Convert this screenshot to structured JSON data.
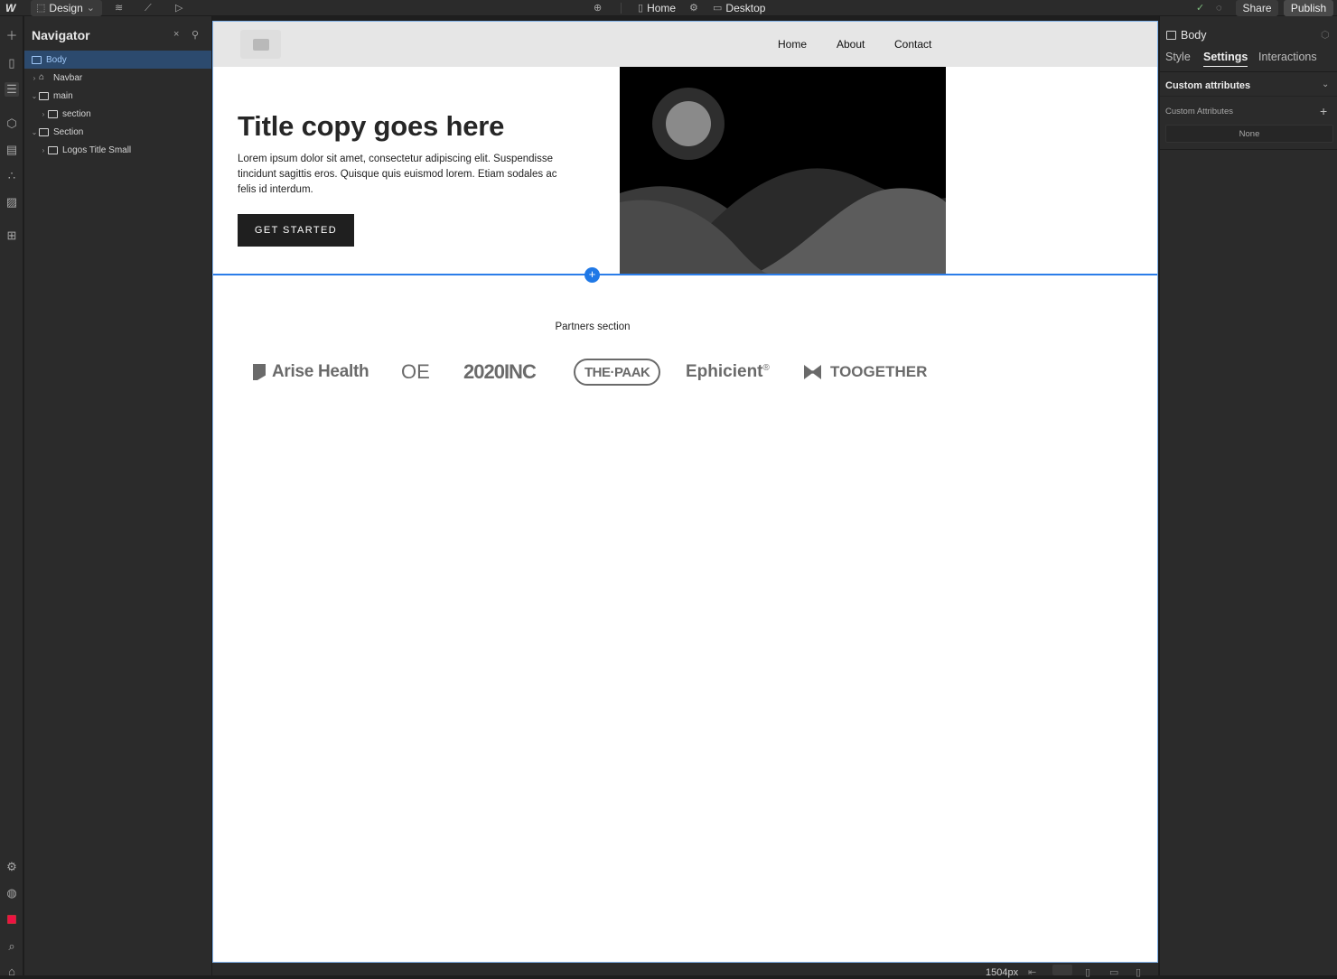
{
  "topbar": {
    "design_label": "Design",
    "page_label": "Home",
    "breakpoint_label": "Desktop",
    "share_label": "Share",
    "publish_label": "Publish"
  },
  "navigator": {
    "title": "Navigator",
    "tree": [
      {
        "label": "Body",
        "selected": true
      },
      {
        "label": "Navbar"
      },
      {
        "label": "main"
      },
      {
        "label": "section"
      },
      {
        "label": "Section"
      },
      {
        "label": "Logos Title Small"
      }
    ]
  },
  "site": {
    "nav_links": [
      "Home",
      "About",
      "Contact"
    ],
    "hero_title": "Title copy goes here",
    "hero_body": "Lorem ipsum dolor sit amet, consectetur adipiscing elit. Suspendisse tincidunt sagittis eros. Quisque quis euismod lorem. Etiam sodales ac felis id interdum.",
    "cta_label": "GET STARTED",
    "partners_heading": "Partners section",
    "partners": [
      "Arise Health",
      "OE",
      "2020INC",
      "THE·PAAK",
      "Ephicient",
      "®",
      "TOOGETHER"
    ]
  },
  "right_panel": {
    "element_label": "Body",
    "tabs": [
      "Style",
      "Settings",
      "Interactions"
    ],
    "section_title": "Custom attributes",
    "attributes_label": "Custom Attributes",
    "empty_value": "None"
  },
  "status": {
    "width_readout": "1504px"
  },
  "colors": {
    "accent": "#1f78e6",
    "selected_row": "#2c4a6e",
    "panel_bg": "#2b2b2b"
  }
}
